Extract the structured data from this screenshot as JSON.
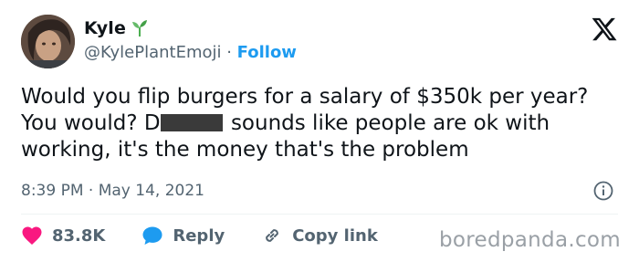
{
  "author": {
    "display_name": "Kyle",
    "emoji_icon": "seedling-icon",
    "handle": "@KylePlantEmoji",
    "separator": " · ",
    "follow_label": "Follow"
  },
  "platform_icon": "x-logo-icon",
  "tweet": {
    "text_part1": "Would you flip burgers for a salary of $350k per year? You would? D",
    "text_part2": " sounds like people are ok with working, it's the money that's the problem"
  },
  "meta": {
    "time": "8:39 PM",
    "separator": " · ",
    "date": "May 14, 2021",
    "info_icon": "info-icon"
  },
  "actions": {
    "likes_count": "83.8K",
    "reply_label": "Reply",
    "copy_link_label": "Copy link"
  },
  "watermark": "boredpanda.com",
  "colors": {
    "accent": "#1d9bf0",
    "heart": "#f91880",
    "secondary_text": "#536471",
    "primary_text": "#0f1419",
    "seedling": "#4caf50"
  }
}
